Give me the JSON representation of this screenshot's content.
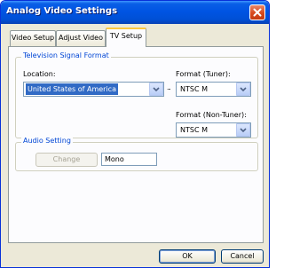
{
  "window": {
    "title": "Analog Video Settings"
  },
  "tabs": [
    {
      "label": "Video Setup",
      "active": false
    },
    {
      "label": "Adjust Video",
      "active": false
    },
    {
      "label": "TV Setup",
      "active": true
    }
  ],
  "tv_signal": {
    "group_label": "Television Signal Format",
    "location_label": "Location:",
    "location_value": "United States of America",
    "connector": "...",
    "format_tuner_label": "Format (Tuner):",
    "format_tuner_value": "NTSC M",
    "format_nontuner_label": "Format (Non-Tuner):",
    "format_nontuner_value": "NTSC M"
  },
  "audio": {
    "group_label": "Audio Setting",
    "change_label": "Change",
    "mode_value": "Mono"
  },
  "footer": {
    "ok_label": "OK",
    "cancel_label": "Cancel"
  },
  "icons": {
    "close": "close-icon",
    "dropdown": "chevron-down-icon"
  },
  "colors": {
    "titlebar": "#0054e3",
    "window_bg": "#ece9d8",
    "group_label": "#0046d5",
    "selection": "#316ac5",
    "active_tab_accent": "#ffc83c"
  }
}
